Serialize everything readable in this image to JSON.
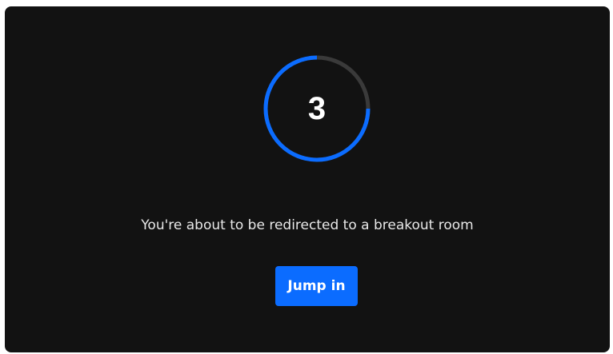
{
  "countdown": {
    "number": "3",
    "progress_fraction": 0.75,
    "track_color": "#3a3a3a",
    "progress_color": "#0b6cff"
  },
  "message": "You're about to be redirected to a breakout room",
  "jump_button": {
    "label": "Jump in",
    "color": "#0b6cff"
  }
}
